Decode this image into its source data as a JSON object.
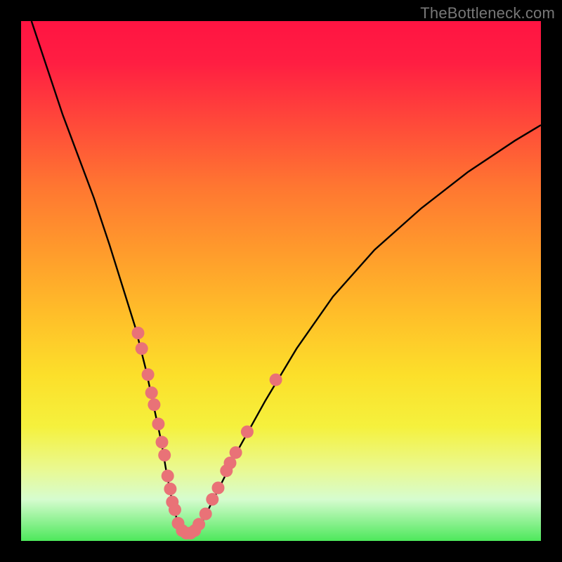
{
  "watermark": "TheBottleneck.com",
  "colors": {
    "dot": "#e97277",
    "curve": "#000000",
    "frame": "#000000"
  },
  "chart_data": {
    "type": "line",
    "title": "",
    "xlabel": "",
    "ylabel": "",
    "xlim": [
      0,
      100
    ],
    "ylim": [
      0,
      100
    ],
    "curve": {
      "x": [
        2,
        5,
        8,
        11,
        14,
        17,
        19.5,
        22,
        24,
        25.5,
        27,
        28,
        29,
        30,
        31.5,
        33,
        35,
        38,
        42,
        47,
        53,
        60,
        68,
        77,
        86,
        95,
        100
      ],
      "y": [
        100,
        91,
        82,
        74,
        66,
        57,
        49,
        41,
        33,
        26,
        19,
        13,
        8,
        4,
        1.5,
        1.5,
        4,
        10,
        18,
        27,
        37,
        47,
        56,
        64,
        71,
        77,
        80
      ]
    },
    "dots": [
      {
        "x": 22.5,
        "y": 40
      },
      {
        "x": 23.2,
        "y": 37
      },
      {
        "x": 24.4,
        "y": 32
      },
      {
        "x": 25.1,
        "y": 28.5
      },
      {
        "x": 25.6,
        "y": 26.2
      },
      {
        "x": 26.4,
        "y": 22.5
      },
      {
        "x": 27.1,
        "y": 19
      },
      {
        "x": 27.6,
        "y": 16.5
      },
      {
        "x": 28.2,
        "y": 12.5
      },
      {
        "x": 28.7,
        "y": 10
      },
      {
        "x": 29.1,
        "y": 7.5
      },
      {
        "x": 29.6,
        "y": 6
      },
      {
        "x": 30.2,
        "y": 3.4
      },
      {
        "x": 31.0,
        "y": 2
      },
      {
        "x": 31.8,
        "y": 1.5
      },
      {
        "x": 32.6,
        "y": 1.5
      },
      {
        "x": 33.4,
        "y": 2
      },
      {
        "x": 34.2,
        "y": 3.2
      },
      {
        "x": 35.5,
        "y": 5.2
      },
      {
        "x": 36.8,
        "y": 8
      },
      {
        "x": 37.9,
        "y": 10.2
      },
      {
        "x": 39.5,
        "y": 13.5
      },
      {
        "x": 40.2,
        "y": 15
      },
      {
        "x": 41.3,
        "y": 17
      },
      {
        "x": 43.5,
        "y": 21
      },
      {
        "x": 49.0,
        "y": 31
      }
    ]
  }
}
